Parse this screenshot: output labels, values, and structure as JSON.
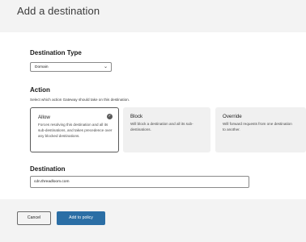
{
  "page": {
    "title": "Add a destination"
  },
  "destination_type": {
    "heading": "Destination Type",
    "selected_value": "Domain",
    "chevron_icon": "chevron-down-icon"
  },
  "action": {
    "heading": "Action",
    "description": "Select which action Gateway should take on this destination.",
    "options": [
      {
        "name": "Allow",
        "description": "Forces resolving this destination and all its sub-destinations, and takes precedence over any blocked destinations.",
        "selected": true
      },
      {
        "name": "Block",
        "description": "Will block a destination and all its sub-destinations.",
        "selected": false
      },
      {
        "name": "Override",
        "description": "Will forward requests from one destination to another.",
        "selected": false
      }
    ]
  },
  "destination": {
    "heading": "Destination",
    "value": "cdn.threadloom.com"
  },
  "footer": {
    "cancel_label": "Cancel",
    "submit_label": "Add to policy"
  },
  "colors": {
    "primary": "#2b6ea5",
    "background": "#f3f3f3",
    "card": "#ffffff"
  }
}
